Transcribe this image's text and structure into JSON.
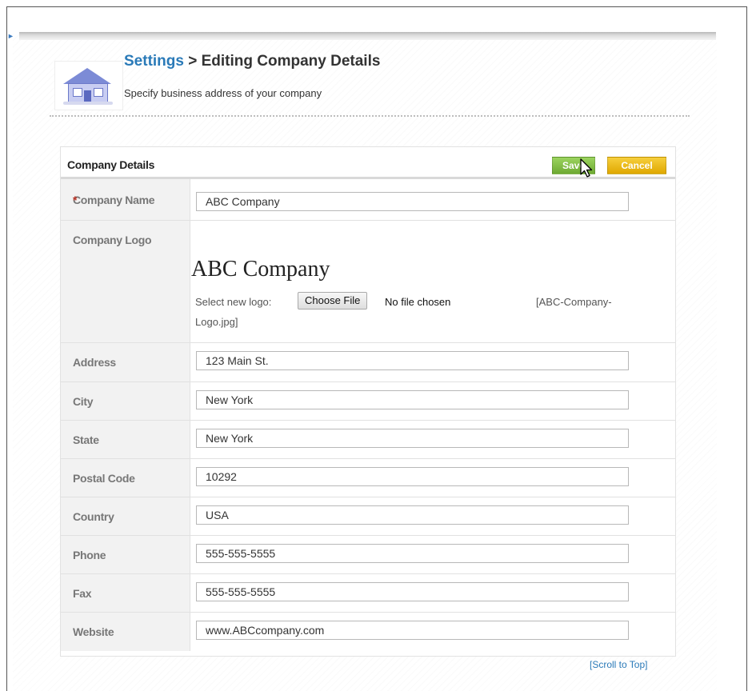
{
  "header": {
    "breadcrumb_link": "Settings",
    "breadcrumb_sep": " > ",
    "title": "Editing Company Details",
    "subtitle": "Specify business address of your company"
  },
  "panel": {
    "title": "Company Details",
    "save_label": "Save",
    "cancel_label": "Cancel"
  },
  "form": {
    "company_name": {
      "required_mark": "*",
      "label": "Company Name",
      "value": "ABC Company"
    },
    "company_logo": {
      "label": "Company Logo",
      "preview_text": "ABC Company",
      "select_label": "Select new logo:",
      "choose_button": "Choose File",
      "no_file": "No file chosen",
      "current_file_part1": "[ABC-Company-",
      "current_file_part2": "Logo.jpg]"
    },
    "address": {
      "label": "Address",
      "value": "123 Main St."
    },
    "city": {
      "label": "City",
      "value": "New York"
    },
    "state": {
      "label": "State",
      "value": "New York"
    },
    "postal_code": {
      "label": "Postal Code",
      "value": "10292"
    },
    "country": {
      "label": "Country",
      "value": "USA"
    },
    "phone": {
      "label": "Phone",
      "value": "555-555-5555"
    },
    "fax": {
      "label": "Fax",
      "value": "555-555-5555"
    },
    "website": {
      "label": "Website",
      "value": "www.ABCcompany.com"
    }
  },
  "footer": {
    "scroll_to_top": "[Scroll to Top]"
  },
  "colors": {
    "link_blue": "#2a7ab8",
    "save_green": "#7cbf3f",
    "cancel_yellow": "#eab20a"
  },
  "icons": [
    "house-icon",
    "mouse-cursor-icon"
  ]
}
